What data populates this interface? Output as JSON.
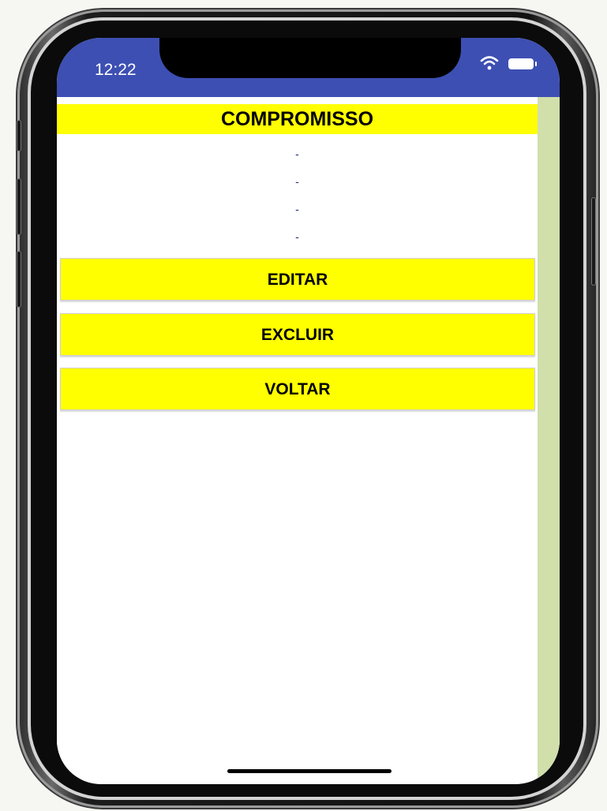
{
  "status_bar": {
    "time": "12:22",
    "color": "#3d4fb3",
    "icons": [
      "wifi-icon",
      "battery-icon"
    ]
  },
  "header": {
    "title": "COMPROMISSO",
    "background": "#ffff00"
  },
  "details": [
    "-",
    "-",
    "-",
    "-"
  ],
  "buttons": {
    "edit_label": "EDITAR",
    "delete_label": "EXCLUIR",
    "back_label": "VOLTAR"
  },
  "colors": {
    "accent": "#ffff00",
    "side_strip": "#d1dfab"
  }
}
